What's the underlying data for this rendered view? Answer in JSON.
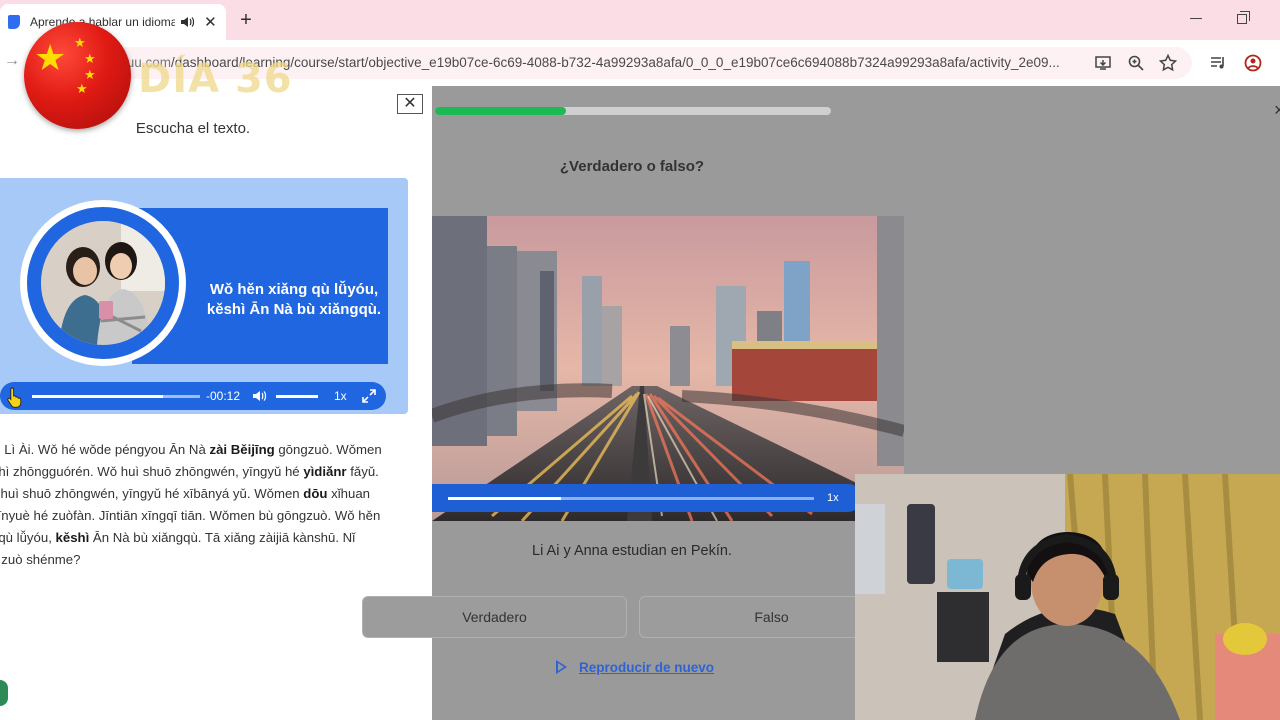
{
  "browser": {
    "tab": {
      "title": "Aprende a hablar un idioma",
      "icon": "busuu-favicon"
    },
    "url": {
      "host": "busuu.com",
      "path": "/dashboard/learning/course/start/objective_e19b07ce-6c69-4088-b732-4a99293a8afa/0_0_0_e19b07ce6c694088b7324a99293a8afa/activity_2e09..."
    },
    "visible_url_prefix": "suu.com",
    "icons": [
      "forward-arrow-icon",
      "install-app-icon",
      "zoom-icon",
      "bookmark-star-icon",
      "media-control-icon",
      "profile-icon",
      "minimize-icon",
      "restore-icon"
    ]
  },
  "overlay": {
    "day_label": "DÍA 36",
    "flag": "china-flag"
  },
  "left_panel": {
    "close_label": "✕",
    "heading": "Escucha el texto.",
    "video_caption_line1": "Wǒ hěn xiǎng qù lǚyóu,",
    "video_caption_line2": "kěshì Ān Nà bù xiǎngqù.",
    "player": {
      "time": "-00:12",
      "rate": "1x",
      "progress": 0.78
    },
    "transcript_lines": [
      [
        {
          "t": "jiào Lì Ài. Wǒ hé wǒde péngyou Ān Nà "
        },
        {
          "t": "zài Běijīng",
          "b": true
        },
        {
          "t": " gōngzuò. Wǒmen"
        }
      ],
      [
        {
          "t": "u",
          "b": true
        },
        {
          "t": " shì zhōngguórén. Wǒ huì shuō zhōngwén, yīngyǔ hé "
        },
        {
          "t": "yìdiǎnr",
          "b": true
        },
        {
          "t": " fǎyǔ."
        }
      ],
      [
        {
          "t": "Nà huì shuō zhōngwén, yīngyǔ hé xībānyá yǔ. Wǒmen "
        },
        {
          "t": "dōu",
          "b": true
        },
        {
          "t": " xǐhuan"
        }
      ],
      [
        {
          "t": "g yīnyuè hé zuòfàn. Jīntiān xīngqī tiān. Wǒmen bù gōngzuò. Wǒ hěn"
        }
      ],
      [
        {
          "t": "ng qù lǚyóu, "
        },
        {
          "t": "kěshì",
          "b": true
        },
        {
          "t": " Ān Nà bù xiǎngqù. Tā xiǎng zàijiā kànshū. Nǐ"
        }
      ],
      [
        {
          "t": "iān zuò shénme?"
        }
      ]
    ]
  },
  "activity": {
    "progress": 0.33,
    "question": "¿Verdadero o falso?",
    "video": {
      "rate": "1x",
      "progress": 0.31
    },
    "statement": "Li Ai y Anna estudian en Pekín.",
    "answers": [
      "Verdadero",
      "Falso"
    ],
    "replay_label": "Reproducir de nuevo",
    "close_label": "×"
  },
  "colors": {
    "tabstrip": "#fbdde6",
    "accent_blue": "#1f66e0",
    "progress_green": "#1db954",
    "dim_overlay": "#9a9a9a"
  }
}
